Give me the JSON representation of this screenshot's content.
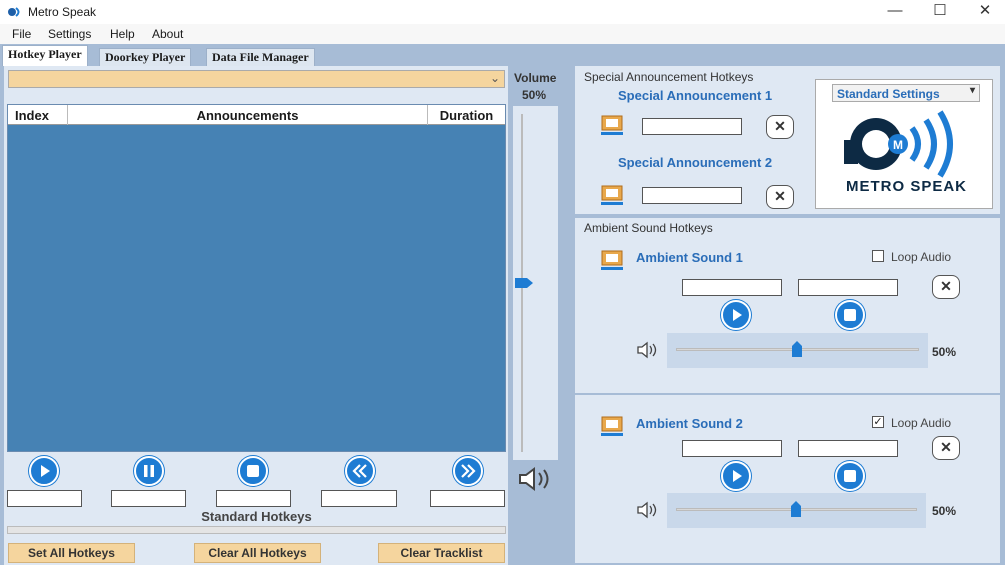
{
  "window": {
    "title": "Metro Speak"
  },
  "menu": [
    "File",
    "Settings",
    "Help",
    "About"
  ],
  "tabs": [
    "Hotkey Player",
    "Doorkey Player",
    "Data File Manager"
  ],
  "table": {
    "headers": [
      "Index",
      "Announcements",
      "Duration"
    ]
  },
  "volume": {
    "label": "Volume",
    "value": "50%"
  },
  "player": {
    "standard_hotkeys_label": "Standard Hotkeys"
  },
  "footer": {
    "set_all": "Set All Hotkeys",
    "clear_all": "Clear All Hotkeys",
    "clear_tracklist": "Clear Tracklist"
  },
  "special": {
    "title": "Special Announcement Hotkeys",
    "sa1": "Special Announcement 1",
    "sa2": "Special Announcement 2",
    "settings_select": "Standard Settings",
    "logo_text": "METRO SPEAK"
  },
  "ambient": {
    "title": "Ambient Sound Hotkeys",
    "s1": {
      "label": "Ambient Sound 1",
      "loop_label": "Loop Audio",
      "loop_checked": false,
      "volume": "50%"
    },
    "s2": {
      "label": "Ambient Sound 2",
      "loop_label": "Loop Audio",
      "loop_checked": true,
      "volume": "50%"
    }
  },
  "colors": {
    "accent": "#1e7cd3",
    "list_bg": "#4682b4",
    "footer_btn": "#f5d59e"
  }
}
